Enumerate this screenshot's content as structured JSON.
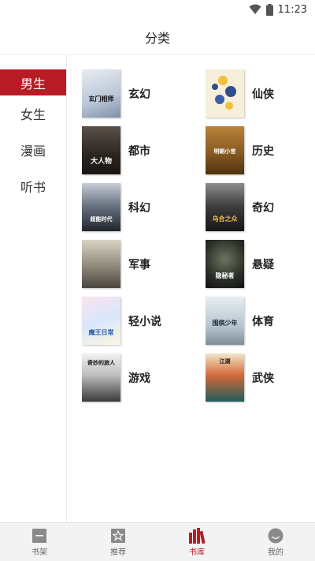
{
  "status": {
    "time": "11:23"
  },
  "header": {
    "title": "分类"
  },
  "sidebar": {
    "items": [
      {
        "label": "男生"
      },
      {
        "label": "女生"
      },
      {
        "label": "漫画"
      },
      {
        "label": "听书"
      }
    ]
  },
  "categories": [
    {
      "label": "玄幻",
      "cover_text": "玄门相师"
    },
    {
      "label": "仙侠",
      "cover_text": ""
    },
    {
      "label": "都市",
      "cover_text": "大人物"
    },
    {
      "label": "历史",
      "cover_text": "明朝小官"
    },
    {
      "label": "科幻",
      "cover_text": "超能时代"
    },
    {
      "label": "奇幻",
      "cover_text": "乌合之众"
    },
    {
      "label": "军事",
      "cover_text": ""
    },
    {
      "label": "悬疑",
      "cover_text": "隐秘者"
    },
    {
      "label": "轻小说",
      "cover_text": "魔王日常"
    },
    {
      "label": "体育",
      "cover_text": "围棋少年"
    },
    {
      "label": "游戏",
      "cover_text": "奇妙的旅人"
    },
    {
      "label": "武侠",
      "cover_text": "江湖"
    }
  ],
  "tabs": [
    {
      "label": "书架"
    },
    {
      "label": "推荐"
    },
    {
      "label": "书库"
    },
    {
      "label": "我的"
    }
  ],
  "colors": {
    "accent": "#b71c25"
  }
}
